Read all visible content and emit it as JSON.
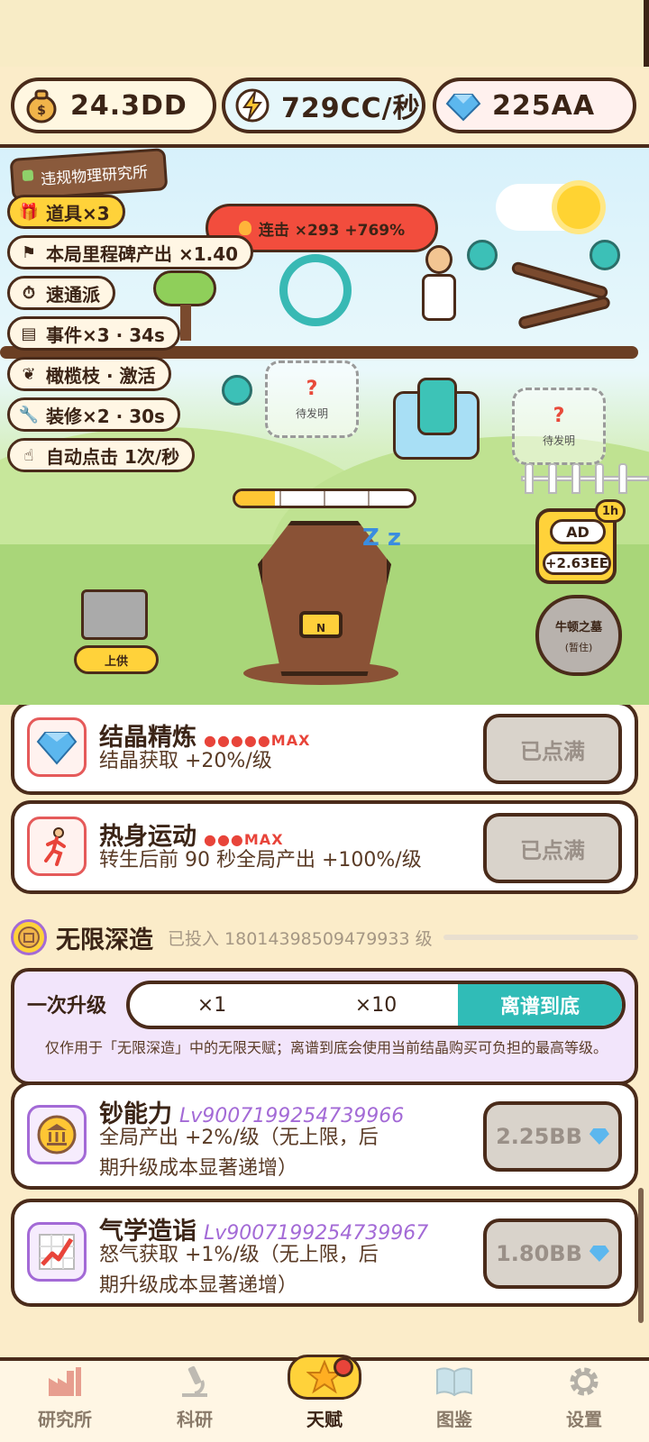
{
  "currencies": {
    "gold": "24.3DD",
    "energy": "729CC/秒",
    "gems": "225AA"
  },
  "scene": {
    "lab_name": "违规物理研究所",
    "buffs": [
      {
        "icon": "gift-icon",
        "label": "道具×3"
      },
      {
        "icon": "flag-icon",
        "label": "本局里程碑产出 ×1.40"
      },
      {
        "icon": "stopwatch-icon",
        "label": "速通派"
      },
      {
        "icon": "newspaper-icon",
        "label": "事件×3 · 34s"
      },
      {
        "icon": "olive-branch-icon",
        "label": "橄榄枝 · 激活"
      },
      {
        "icon": "wrench-icon",
        "label": "装修×2 · 30s"
      },
      {
        "icon": "pointer-hand-icon",
        "label": "自动点击 1次/秒"
      }
    ],
    "combo": "连击 ×293 +769%",
    "mystery_1": {
      "mark": "?",
      "label": "待发明"
    },
    "mystery_2": {
      "mark": "?",
      "label": "待发明"
    },
    "progress_fraction": 0.22,
    "coffin_plate": "N",
    "sleep_text": "Z z",
    "offer_button": "上供",
    "ad": {
      "label": "AD",
      "amount": "+2.63EE",
      "timer": "1h"
    },
    "tomb": {
      "name": "牛顿之墓",
      "status": "(暂住)"
    }
  },
  "talents": [
    {
      "title": "结晶精炼",
      "dots": "●●●●●MAX",
      "desc": "结晶获取 +20%/级",
      "button": "已点满",
      "icon": "diamond-icon"
    },
    {
      "title": "热身运动",
      "dots": "●●●MAX",
      "desc": "转生后前 90 秒全局产出 +100%/级",
      "button": "已点满",
      "icon": "runner-icon"
    }
  ],
  "infinite": {
    "title": "无限深造",
    "invested": "已投入 18014398509479933 级",
    "upgrade_label": "一次升级",
    "options": [
      "×1",
      "×10",
      "离谱到底"
    ],
    "note": "仅作用于「无限深造」中的无限天赋；离谱到底会使用当前结晶购买可负担的最高等级。"
  },
  "infinite_talents": [
    {
      "title": "钞能力",
      "level": "Lv9007199254739966",
      "desc": "全局产出 +2%/级（无上限，后期升级成本显著递增）",
      "cost": "2.25BB",
      "icon": "bank-coin-icon"
    },
    {
      "title": "气学造诣",
      "level": "Lv9007199254739967",
      "desc": "怒气获取 +1%/级（无上限，后期升级成本显著递增）",
      "cost": "1.80BB",
      "icon": "chart-up-icon"
    }
  ],
  "tabs": [
    {
      "label": "研究所",
      "icon": "factory-icon"
    },
    {
      "label": "科研",
      "icon": "microscope-icon"
    },
    {
      "label": "天赋",
      "icon": "star-icon"
    },
    {
      "label": "图鉴",
      "icon": "book-icon"
    },
    {
      "label": "设置",
      "icon": "gear-icon"
    }
  ],
  "colors": {
    "accent_teal": "#30bcb7",
    "gold": "#ffd23a",
    "brown": "#4a2b1a",
    "purple": "#a36ad6",
    "red": "#e8443a"
  }
}
